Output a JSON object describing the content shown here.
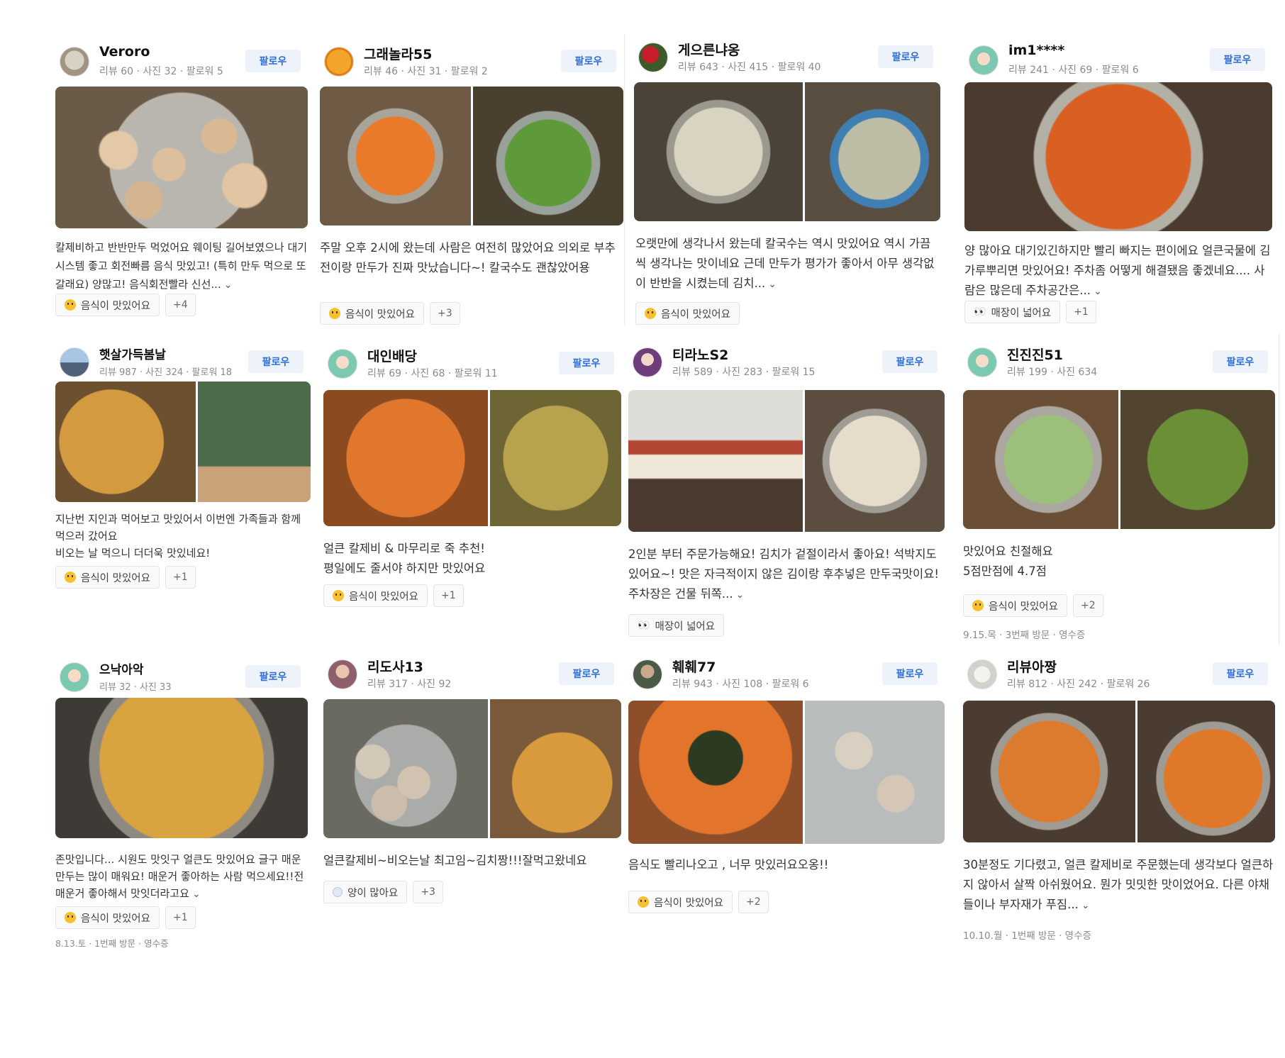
{
  "follow_label": "팔로우",
  "cards": [
    {
      "name": "Veroro",
      "stats": "리뷰 60 · 사진 32 · 팔로워 5",
      "review": "칼제비하고 반반만두 먹었어요 웨이팅 길어보였으나 대기시스템 좋고 회전빠름 음식 맛있고! (특히 만두 먹으로 또 갈래요) 양많고! 음식회전빨라 신선...",
      "tag": "음식이 맛있어요",
      "tag_more": "+4",
      "visit": ""
    },
    {
      "name": "그래놀라55",
      "stats": "리뷰 46 · 사진 31 · 팔로워 2",
      "review": "주말 오후 2시에 왔는데 사람은 여전히 많았어요 의외로 부추전이랑 만두가 진짜 맛났습니다~! 칼국수도 괜찮았어용",
      "tag": "음식이 맛있어요",
      "tag_more": "+3",
      "visit": ""
    },
    {
      "name": "게으른냐옹",
      "stats": "리뷰 643 · 사진 415 · 팔로워 40",
      "review": "오랫만에 생각나서 왔는데 칼국수는 역시 맛있어요 역시 가끔씩 생각나는 맛이네요 근데 만두가 평가가 좋아서 아무 생각없이 반반을 시켰는데 김치...",
      "tag": "음식이 맛있어요",
      "tag_more": "",
      "visit": ""
    },
    {
      "name": "im1****",
      "stats": "리뷰 241 · 사진 69 · 팔로워 6",
      "review": "양 많아요 대기있긴하지만 빨리 빠지는 편이에요 얼큰국물에 김가루뿌리면 맛있어요! 주차좀 어떻게 해결됐음 좋겠네요.... 사람은 많은데 주차공간은...",
      "tag": "매장이 넓어요",
      "tag_more": "+1",
      "visit": ""
    },
    {
      "name": "햇살가득봄날",
      "stats": "리뷰 987 · 사진 324 · 팔로워 18",
      "review": "지난번 지인과 먹어보고 맛있어서 이번엔 가족들과 함께 먹으러 갔어요\n비오는 날 먹으니 더더욱 맛있네요!",
      "tag": "음식이 맛있어요",
      "tag_more": "+1",
      "visit": ""
    },
    {
      "name": "대인배당",
      "stats": "리뷰 69 · 사진 68 · 팔로워 11",
      "review": "얼큰 칼제비 & 마무리로 죽 추천!\n평일에도 줄서야 하지만 맛있어요",
      "tag": "음식이 맛있어요",
      "tag_more": "+1",
      "visit": ""
    },
    {
      "name": "티라노S2",
      "stats": "리뷰 589 · 사진 283 · 팔로워 15",
      "review": "2인분 부터 주문가능해요! 김치가 겉절이라서 좋아요! 석박지도있어요~! 맛은 자극적이지 않은 김이랑 후추넣은 만두국맛이요! 주차장은 건물 뒤쪽...",
      "tag": "매장이 넓어요",
      "tag_more": "",
      "visit": ""
    },
    {
      "name": "진진진51",
      "stats": "리뷰 199 · 사진 634",
      "review": "맛있어요 친절해요\n5점만점에 4.7점",
      "tag": "음식이 맛있어요",
      "tag_more": "+2",
      "visit": "9.15.목 · 3번째 방문 · 영수증"
    },
    {
      "name": "으낙아악",
      "stats": "리뷰 32 · 사진 33",
      "review": "존맛입니다... 시원도 맛잇구 얼큰도 맛있어요 글구 매운만두는 많이 매워요! 매운거 좋아하는 사람 먹으세요!!전 매운거 좋아해서 맛잇더라고요",
      "tag": "음식이 맛있어요",
      "tag_more": "+1",
      "visit": "8.13.토 · 1번째 방문 · 영수증"
    },
    {
      "name": "리도사13",
      "stats": "리뷰 317 · 사진 92",
      "review": "얼큰칼제비~비오는날 최고임~김치짱!!!잘먹고왔네요",
      "tag": "양이 많아요",
      "tag_more": "+3",
      "visit": ""
    },
    {
      "name": "훼훼77",
      "stats": "리뷰 943 · 사진 108 · 팔로워 6",
      "review": "음식도 빨리나오고 , 너무 맛있러요오옹!!",
      "tag": "음식이 맛있어요",
      "tag_more": "+2",
      "visit": ""
    },
    {
      "name": "리뷰아짱",
      "stats": "리뷰 812 · 사진 242 · 팔로워 26",
      "review": "30분정도 기다렸고, 얼큰 칼제비로 주문했는데 생각보다 얼큰하지 않아서 살짝 아쉬웠어요. 뭔가 밋밋한 맛이었어요. 다른 야채들이나 부자재가 푸짐...",
      "tag": "",
      "tag_more": "",
      "visit": "10.10.월 · 1번째 방문 · 영수증"
    }
  ],
  "colors": {
    "follow_bg": "#eef3fb",
    "follow_text": "#2f6fd6"
  }
}
